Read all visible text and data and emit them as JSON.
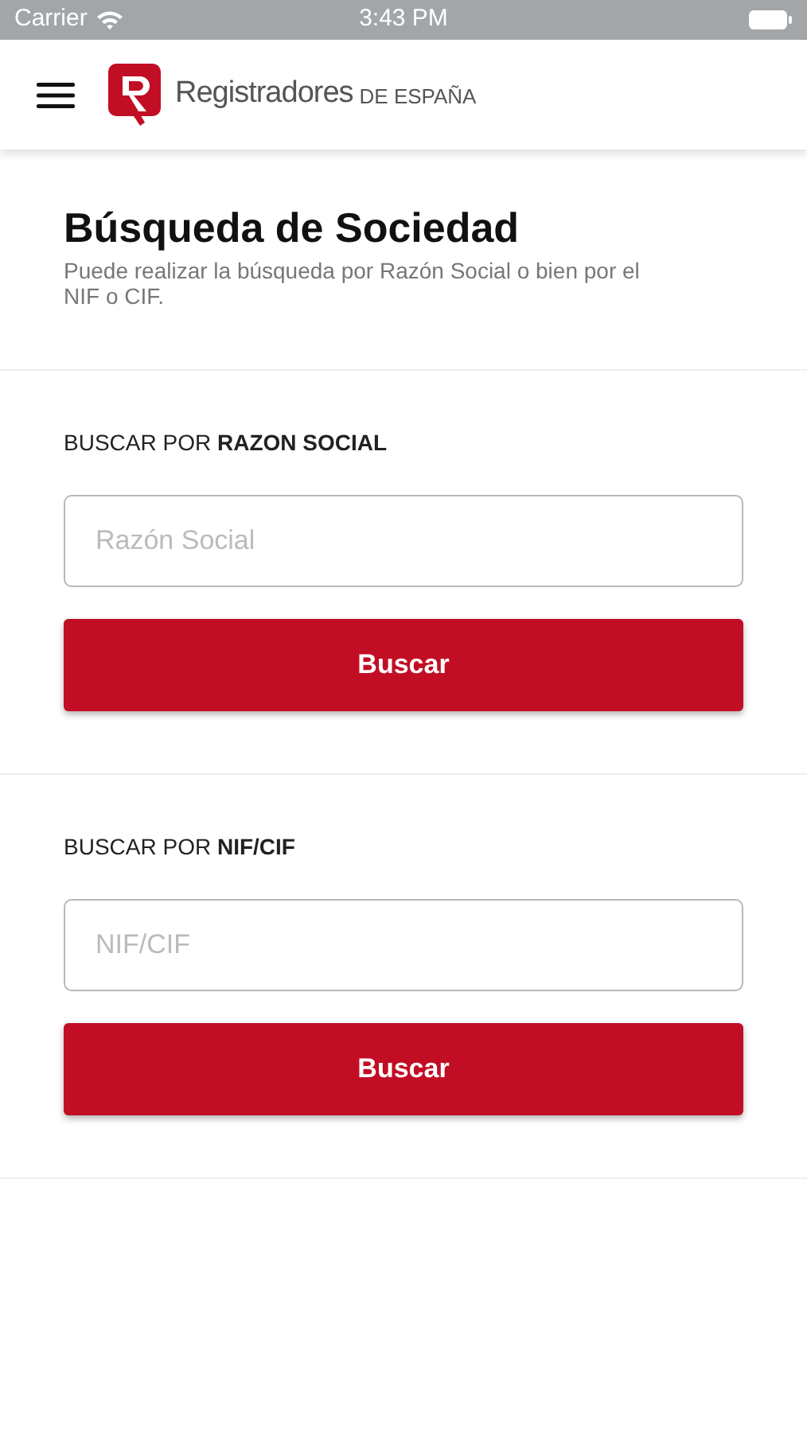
{
  "status_bar": {
    "carrier": "Carrier",
    "time": "3:43 PM"
  },
  "header": {
    "brand": "Registradores",
    "brand_suffix": "DE ESPAÑA"
  },
  "title": "Búsqueda de Sociedad",
  "subtitle": "Puede realizar la búsqueda por Razón Social o bien por el NIF o CIF.",
  "sections": [
    {
      "label": "BUSCAR POR **RAZON SOCIAL**",
      "placeholder": "Razón Social",
      "button": "Buscar"
    },
    {
      "label": "BUSCAR POR **NIF/CIF**",
      "placeholder": "NIF/CIF",
      "button": "Buscar"
    }
  ]
}
